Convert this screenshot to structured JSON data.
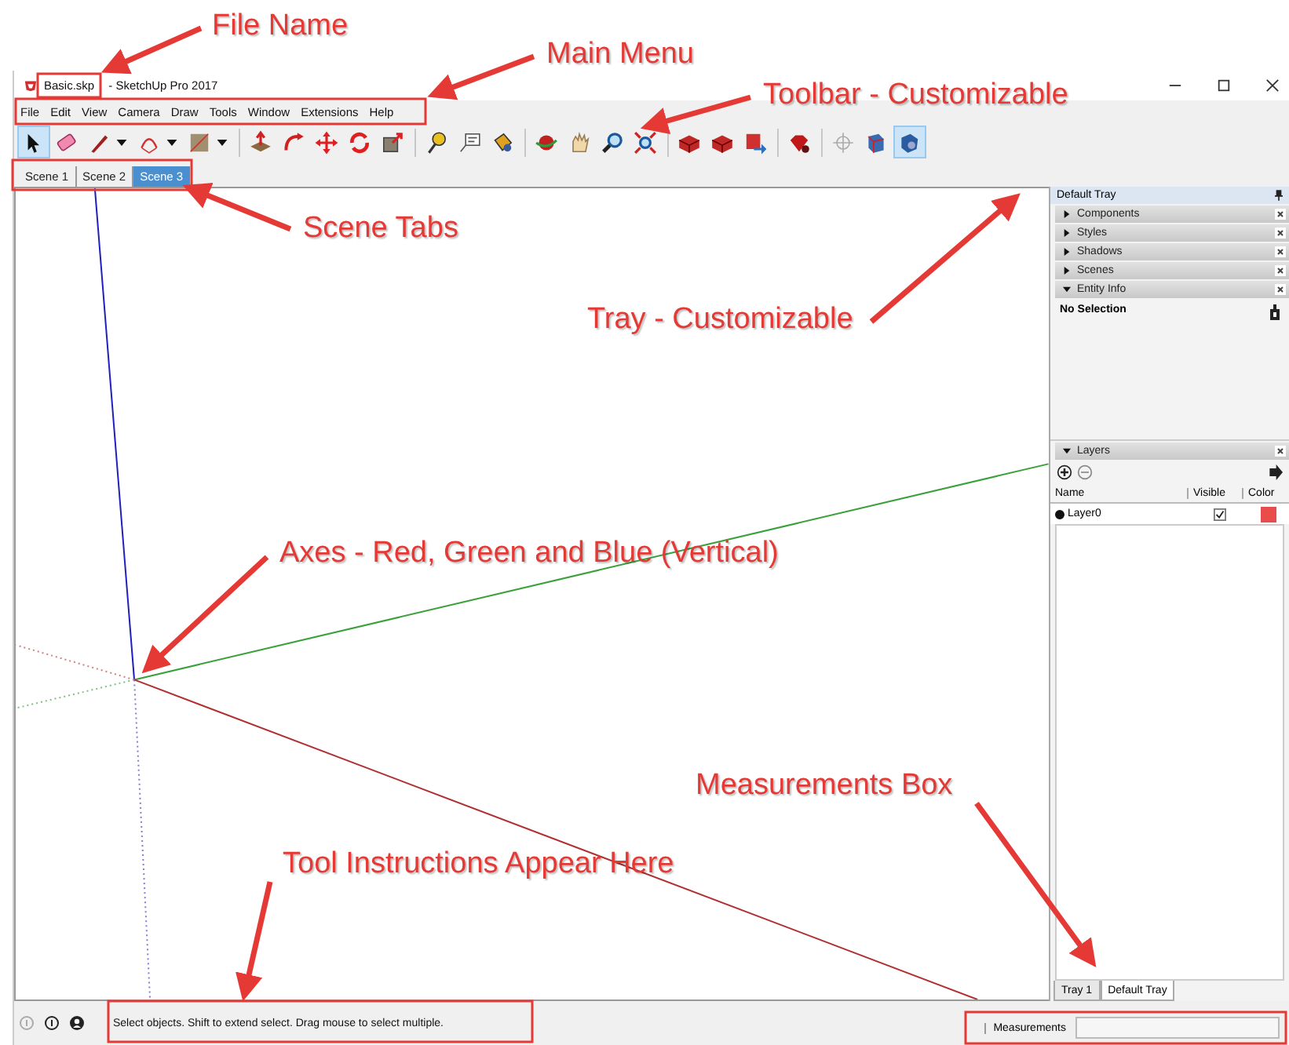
{
  "annotations": [
    {
      "text": "File Name"
    },
    {
      "text": "Main Menu"
    },
    {
      "text": "Toolbar - Customizable"
    },
    {
      "text": "Scene Tabs"
    },
    {
      "text": "Tray - Customizable"
    },
    {
      "text": "Axes - Red, Green and Blue (Vertical)"
    },
    {
      "text": "Measurements Box"
    },
    {
      "text": "Tool Instructions Appear Here"
    }
  ],
  "window": {
    "file_name": "Basic.skp",
    "title_rest": "- SketchUp Pro 2017"
  },
  "menu": [
    "File",
    "Edit",
    "View",
    "Camera",
    "Draw",
    "Tools",
    "Window",
    "Extensions",
    "Help"
  ],
  "toolbar": [
    {
      "tools": [
        {
          "kind": "select",
          "selected": true
        },
        {
          "kind": "eraser",
          "selected": false
        },
        {
          "kind": "pencil",
          "selected": false
        },
        {
          "kind": "arc",
          "selected": false
        },
        {
          "kind": "rectangle",
          "selected": false
        }
      ]
    },
    {
      "tools": [
        {
          "kind": "pushpull",
          "selected": false
        },
        {
          "kind": "followme",
          "selected": false
        },
        {
          "kind": "move",
          "selected": false
        },
        {
          "kind": "rotate",
          "selected": false
        },
        {
          "kind": "scale",
          "selected": false
        }
      ]
    },
    {
      "tools": [
        {
          "kind": "tape",
          "selected": false
        },
        {
          "kind": "text",
          "selected": false
        },
        {
          "kind": "paint",
          "selected": false
        }
      ]
    },
    {
      "tools": [
        {
          "kind": "orbit",
          "selected": false
        },
        {
          "kind": "pan",
          "selected": false
        },
        {
          "kind": "zoom",
          "selected": false
        },
        {
          "kind": "zoomextents",
          "selected": false
        }
      ]
    },
    {
      "tools": [
        {
          "kind": "warehouse",
          "selected": false
        },
        {
          "kind": "warehouse",
          "selected": false
        },
        {
          "kind": "share",
          "selected": false
        }
      ]
    },
    {
      "tools": [
        {
          "kind": "ruby",
          "selected": false
        }
      ]
    },
    {
      "tools": [
        {
          "kind": "crosshair",
          "selected": false
        },
        {
          "kind": "section",
          "selected": false
        },
        {
          "kind": "viewpoint",
          "selected": true
        }
      ]
    }
  ],
  "scene_tabs": [
    {
      "label": "Scene 1",
      "selected": false
    },
    {
      "label": "Scene 2",
      "selected": false
    },
    {
      "label": "Scene 3",
      "selected": true
    }
  ],
  "tray": {
    "title": "Default Tray",
    "panels": [
      {
        "name": "Components",
        "expanded": false
      },
      {
        "name": "Styles",
        "expanded": false
      },
      {
        "name": "Shadows",
        "expanded": false
      },
      {
        "name": "Scenes",
        "expanded": false
      },
      {
        "name": "Entity Info",
        "expanded": true
      }
    ],
    "entity_info": {
      "selection": "No Selection"
    },
    "layers": {
      "title": "Layers",
      "expanded": true,
      "columns": [
        "Name",
        "Visible",
        "Color"
      ],
      "rows": [
        {
          "name": "Layer0",
          "current": true,
          "visible": true,
          "color": "#e84c4c"
        }
      ]
    },
    "tabs": [
      {
        "label": "Tray 1",
        "selected": false
      },
      {
        "label": "Default Tray",
        "selected": true
      }
    ]
  },
  "status_bar": {
    "instruction": "Select objects. Shift to extend select. Drag mouse to select multiple.",
    "measurements_label": "Measurements"
  }
}
